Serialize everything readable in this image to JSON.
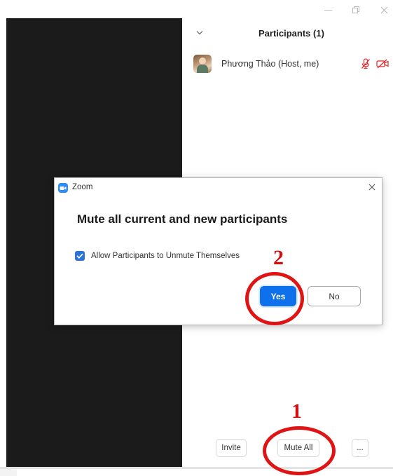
{
  "window": {
    "controls": [
      "minimize",
      "restore",
      "close"
    ]
  },
  "participants_panel": {
    "title": "Participants (1)",
    "participants": [
      {
        "name": "Phương Thảo (Host, me)",
        "audio": "muted",
        "video": "off"
      }
    ],
    "footer": {
      "invite_label": "Invite",
      "mute_all_label": "Mute All",
      "more_label": "..."
    }
  },
  "dialog": {
    "app_name": "Zoom",
    "heading": "Mute all current and new participants",
    "checkbox_label": "Allow Participants to Unmute Themselves",
    "checkbox_checked": true,
    "yes_label": "Yes",
    "no_label": "No"
  },
  "annotations": {
    "step_1": "1",
    "step_2": "2"
  },
  "colors": {
    "zoom_blue": "#0e71eb",
    "annotation_red": "#d10f0f",
    "muted_icon_red": "#e02828",
    "video_bg": "#1b1b1b"
  }
}
